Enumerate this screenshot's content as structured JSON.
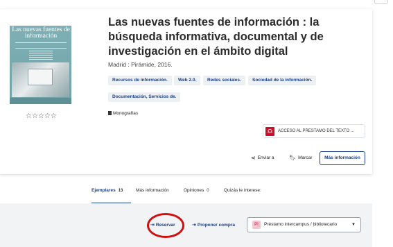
{
  "record": {
    "cover": {
      "title_text": "Las nuevas fuentes de información"
    },
    "rating_stars": "☆☆☆☆☆",
    "title": "Las nuevas fuentes de información : la búsqueda informativa, documental y de investigación en el ámbito digital",
    "publication": "Madrid : Pirámide, 2016.",
    "subjects": [
      "Recursos de información.",
      "Web 2.0.",
      "Redes sociales.",
      "Sociedad de la información.",
      "Documentación, Servicios de."
    ],
    "format": "Monografías",
    "access_button": "ACCESO AL PRESTAMO DEL TEXTO ...",
    "actions": {
      "send": "Enviar a",
      "mark": "Marcar",
      "more_info": "Más información"
    }
  },
  "tabs": [
    {
      "label": "Ejemplares",
      "count": "13"
    },
    {
      "label": "Más información",
      "count": ""
    },
    {
      "label": "Opiniones",
      "count": "0"
    },
    {
      "label": "Quizás le interese:",
      "count": ""
    }
  ],
  "holdings_actions": {
    "reserve": "Reservar",
    "propose": "Proponer compra",
    "loan_badge": "PI",
    "loan_select": "Préstamo intercampus / bibliotecario"
  },
  "icons": {
    "share": "share-icon",
    "bookmark": "bookmark-icon",
    "login": "sign-in-icon",
    "caret": "caret-down-icon",
    "pdf": "pdf-icon"
  },
  "colors": {
    "accent": "#1a3e87",
    "highlight_circle": "#d01010",
    "access_icon": "#c8102e"
  }
}
